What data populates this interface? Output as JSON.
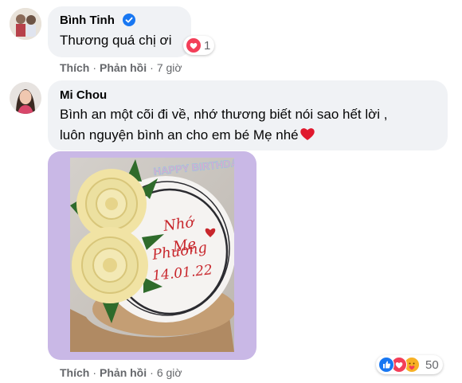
{
  "comments": [
    {
      "author": "Bình Tinh",
      "text": "Thương quá chị ơi",
      "reaction_count": "1",
      "actions": {
        "like": "Thích",
        "reply": "Phản hồi",
        "time": "7 giờ"
      }
    },
    {
      "author": "Mi Chou",
      "text_line1": "Bình an một cõi đi về, nhớ thương biết nói sao hết lời ,",
      "text_line2": "luôn nguyện bình an cho em bé Mẹ nhé",
      "photo": {
        "topper": "HAPPY BIRTHDAY",
        "cake_line1": "Nhớ",
        "cake_line2": "Mẹ",
        "cake_line3": "Phương",
        "cake_date": "14.01.22"
      },
      "reaction_count": "50",
      "actions": {
        "like": "Thích",
        "reply": "Phản hồi",
        "time": "6 giờ"
      }
    }
  ],
  "colors": {
    "bubble": "#f0f2f5",
    "verified": "#1877f2",
    "heart": "#f33e58",
    "like": "#1877f2",
    "care": "#f7b125"
  }
}
